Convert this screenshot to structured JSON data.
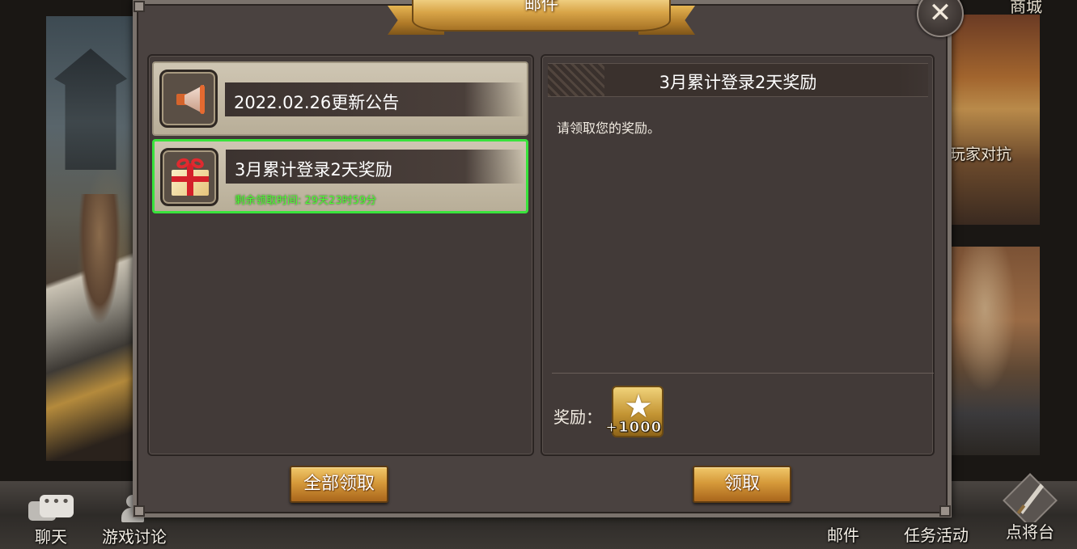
{
  "background": {
    "shop_label": "商城",
    "pvp_label": "玩家对抗"
  },
  "dialog": {
    "title": "邮件",
    "close_icon": "close-x-icon"
  },
  "mail_list": [
    {
      "icon": "megaphone-icon",
      "title": "2022.02.26更新公告",
      "selected": false
    },
    {
      "icon": "gift-box-icon",
      "title": "3月累计登录2天奖励",
      "remaining": "剩余领取时间: 29天23时59分",
      "selected": true
    }
  ],
  "detail": {
    "title": "3月累计登录2天奖励",
    "body": "请领取您的奖励。",
    "reward_label": "奖励：",
    "reward_icon": "star-icon",
    "reward_amount": "+1000"
  },
  "buttons": {
    "claim_all": "全部领取",
    "claim": "领取"
  },
  "bottom_nav": {
    "chat": "聊天",
    "discussion": "游戏讨论",
    "mail": "邮件",
    "tasks": "任务活动",
    "generals": "点将台"
  },
  "colors": {
    "selected_border": "#39e33c",
    "remaining_text": "#4bff35",
    "gold_button": "#d69a3a"
  }
}
